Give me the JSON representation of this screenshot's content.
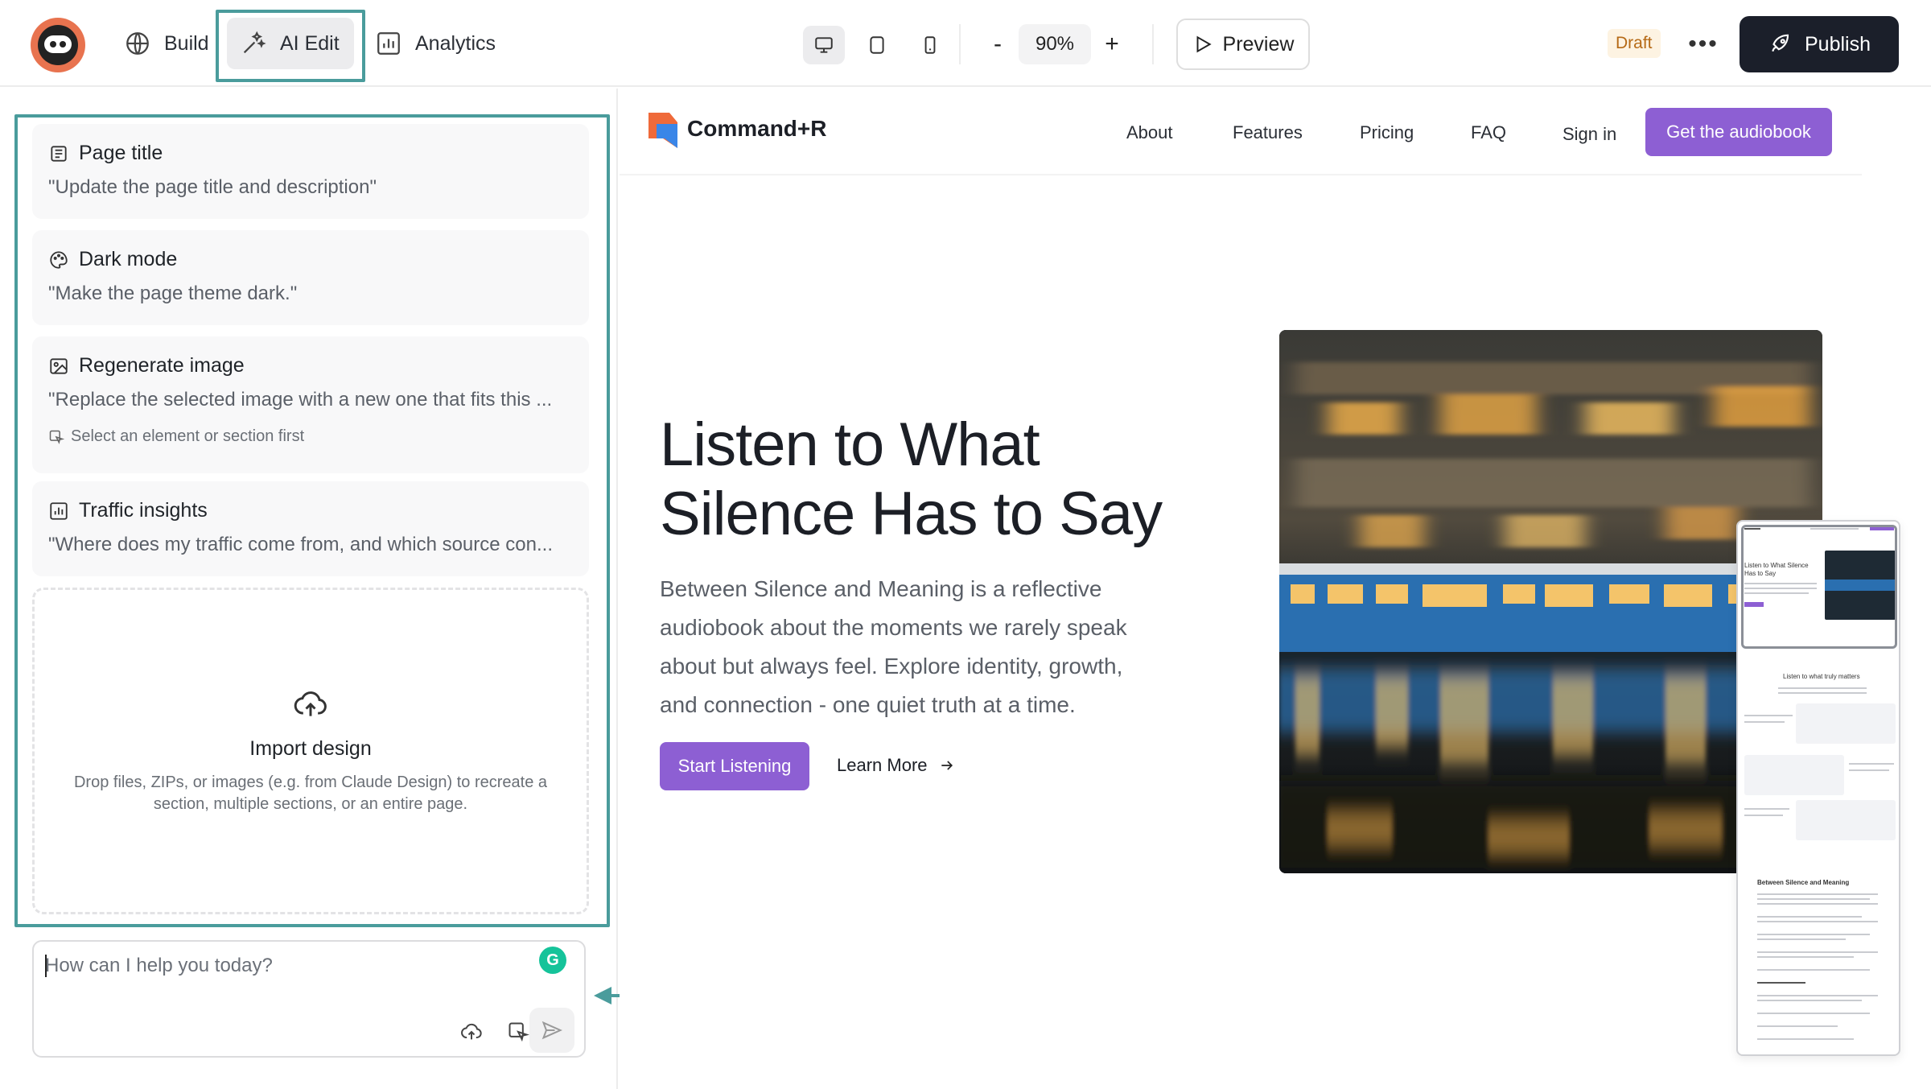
{
  "topbar": {
    "nav": {
      "build": "Build",
      "ai_edit": "AI Edit",
      "analytics": "Analytics"
    },
    "zoom": {
      "minus": "-",
      "value": "90%",
      "plus": "+"
    },
    "preview": "Preview",
    "status": "Draft",
    "more": "•••",
    "publish": "Publish"
  },
  "ai_panel": {
    "suggestions": [
      {
        "title": "Page title",
        "prompt": "\"Update the page title and description\""
      },
      {
        "title": "Dark mode",
        "prompt": "\"Make the page theme dark.\""
      },
      {
        "title": "Regenerate image",
        "prompt": "\"Replace the selected image with a new one that fits this ...",
        "hint": "Select an element or section first"
      },
      {
        "title": "Traffic insights",
        "prompt": "\"Where does my traffic come from, and which source con..."
      }
    ],
    "import": {
      "title": "Import design",
      "description": "Drop files, ZIPs, or images (e.g. from Claude Design) to recreate a section, multiple sections, or an entire page."
    },
    "chat": {
      "placeholder": "How can I help you today?"
    }
  },
  "site": {
    "brand": "Command+R",
    "nav": [
      "About",
      "Features",
      "Pricing",
      "FAQ",
      "Sign in"
    ],
    "cta": "Get the audiobook",
    "hero": {
      "title_line1": "Listen to What",
      "title_line2": "Silence Has to Say",
      "body": "Between Silence and Meaning is a reflective audiobook about the moments we rarely speak about but always feel. Explore identity, growth, and connection - one quiet truth at a time.",
      "primary_button": "Start Listening",
      "secondary_link": "Learn More"
    }
  },
  "minimap": {
    "hero_title": "Listen to What Silence Has to Say",
    "section_title": "Listen to what truly matters",
    "book_title": "Between Silence and Meaning"
  },
  "colors": {
    "accent_teal": "#4a9c9c",
    "brand_purple": "#8d5fd3",
    "publish_dark": "#1b1f2a",
    "draft_text": "#b66a16",
    "logo_orange": "#e8734f"
  }
}
